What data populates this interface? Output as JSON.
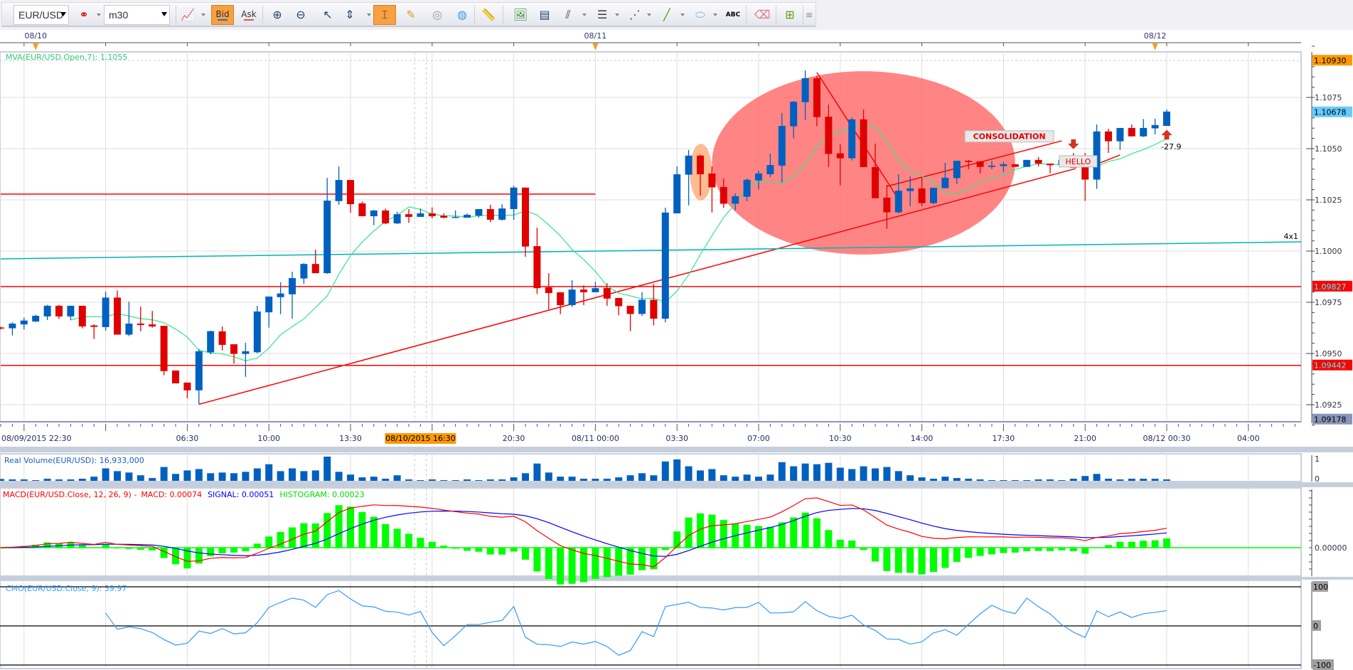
{
  "toolbar": {
    "symbol": "EUR/USD",
    "timeframe": "m30",
    "bid_label": "Bid",
    "ask_label": "Ask",
    "text_tool_label": "ABC"
  },
  "chart_data": {
    "type": "candlestick",
    "symbol": "EUR/USD",
    "interval": "m30",
    "x_start": "08/09/2015 22:30",
    "colors": {
      "up": "#0060c0",
      "down": "#e00000",
      "mva": "#2ee88a",
      "macd": "#ff0000",
      "signal": "#0000ff",
      "histogram": "#00ff00",
      "cmo": "#3399ff",
      "volume": "#0060c0"
    },
    "date_markers": [
      {
        "label": "08/10",
        "index": 3
      },
      {
        "label": "08/11",
        "index": 51
      },
      {
        "label": "08/12",
        "index": 99
      }
    ],
    "time_labels": [
      {
        "label": "08/09/2015 22:30",
        "index": 0
      },
      {
        "label": "06:30",
        "index": 16
      },
      {
        "label": "10:00",
        "index": 23
      },
      {
        "label": "13:30",
        "index": 30
      },
      {
        "label": "20:30",
        "index": 44
      },
      {
        "label": "08/11 00:00",
        "index": 51
      },
      {
        "label": "03:30",
        "index": 58
      },
      {
        "label": "07:00",
        "index": 65
      },
      {
        "label": "10:30",
        "index": 72
      },
      {
        "label": "14:00",
        "index": 79
      },
      {
        "label": "17:30",
        "index": 86
      },
      {
        "label": "21:00",
        "index": 93
      },
      {
        "label": "08/12 00:30",
        "index": 100
      },
      {
        "label": "04:00",
        "index": 107
      }
    ],
    "crosshair": {
      "label": "08/10/2015 16:30",
      "index": 36
    },
    "y_axis": {
      "range": [
        1.0912,
        1.11
      ],
      "ticks": [
        "1.1075",
        "1.1050",
        "1.1025",
        "1.1000",
        "1.0975",
        "1.0950",
        "1.0925"
      ],
      "markers": [
        {
          "label": "1.10930",
          "bg": "#ff9900",
          "fg": "#000000"
        },
        {
          "label": "1.10678",
          "bg": "#66ccff",
          "fg": "#000000"
        },
        {
          "label": "1.09827",
          "bg": "#ff0000",
          "fg": "#33ffff"
        },
        {
          "label": "1.09442",
          "bg": "#ff0000",
          "fg": "#33ffff"
        },
        {
          "label": "1.09178",
          "bg": "#8a96b8",
          "fg": "#000000"
        }
      ]
    },
    "mva": {
      "label": "MVA(EUR/USD.Open,7): 1.1055",
      "period": 7,
      "source": "open"
    },
    "candles": [
      [
        1.09627,
        1.09631,
        1.09617,
        1.09623
      ],
      [
        1.09623,
        1.09652,
        1.09588,
        1.09646
      ],
      [
        1.09642,
        1.09675,
        1.09617,
        1.09661
      ],
      [
        1.09656,
        1.09689,
        1.09654,
        1.09684
      ],
      [
        1.09681,
        1.09737,
        1.09663,
        1.09733
      ],
      [
        1.09733,
        1.09737,
        1.09669,
        1.09681
      ],
      [
        1.09681,
        1.09733,
        1.09663,
        1.09733
      ],
      [
        1.09733,
        1.09733,
        1.09623,
        1.09632
      ],
      [
        1.09637,
        1.09642,
        1.09571,
        1.0963
      ],
      [
        1.09629,
        1.09802,
        1.09611,
        1.09773
      ],
      [
        1.09773,
        1.09808,
        1.09592,
        1.09592
      ],
      [
        1.09592,
        1.09753,
        1.09585,
        1.09646
      ],
      [
        1.09646,
        1.09729,
        1.09608,
        1.09639
      ],
      [
        1.09642,
        1.09708,
        1.09626,
        1.09632
      ],
      [
        1.09635,
        1.09635,
        1.09394,
        1.09414
      ],
      [
        1.09417,
        1.09417,
        1.09354,
        1.09354
      ],
      [
        1.09358,
        1.09358,
        1.09281,
        1.0932
      ],
      [
        1.0932,
        1.09522,
        1.09252,
        1.09511
      ],
      [
        1.09506,
        1.09611,
        1.09496,
        1.09609
      ],
      [
        1.09608,
        1.09632,
        1.09515,
        1.09542
      ],
      [
        1.09545,
        1.09545,
        1.0945,
        1.09498
      ],
      [
        1.09498,
        1.09552,
        1.09386,
        1.09511
      ],
      [
        1.09506,
        1.09733,
        1.09501,
        1.09705
      ],
      [
        1.09701,
        1.09778,
        1.09626,
        1.09778
      ],
      [
        1.09775,
        1.09848,
        1.09692,
        1.09793
      ],
      [
        1.09789,
        1.09899,
        1.0967,
        1.09868
      ],
      [
        1.09866,
        1.09941,
        1.0984,
        1.09937
      ],
      [
        1.09937,
        1.10007,
        1.09892,
        1.09892
      ],
      [
        1.09892,
        1.10357,
        1.09889,
        1.10246
      ],
      [
        1.10244,
        1.10413,
        1.10226,
        1.10347
      ],
      [
        1.10347,
        1.10347,
        1.10187,
        1.10229
      ],
      [
        1.10233,
        1.10242,
        1.1017,
        1.1017
      ],
      [
        1.1017,
        1.10201,
        1.10126,
        1.10198
      ],
      [
        1.10198,
        1.10207,
        1.10132,
        1.10135
      ],
      [
        1.10135,
        1.10192,
        1.10132,
        1.1018
      ],
      [
        1.1018,
        1.10205,
        1.10138,
        1.10167
      ],
      [
        1.10167,
        1.10207,
        1.10167,
        1.10184
      ],
      [
        1.10184,
        1.10213,
        1.1016,
        1.1017
      ],
      [
        1.10172,
        1.10184,
        1.1016,
        1.10163
      ],
      [
        1.10163,
        1.10198,
        1.10161,
        1.10167
      ],
      [
        1.10163,
        1.10184,
        1.10163,
        1.10177
      ],
      [
        1.10173,
        1.10205,
        1.10163,
        1.10205
      ],
      [
        1.10205,
        1.10226,
        1.10141,
        1.10153
      ],
      [
        1.10153,
        1.10228,
        1.10149,
        1.10208
      ],
      [
        1.10205,
        1.10319,
        1.10153,
        1.1031
      ],
      [
        1.1031,
        1.1031,
        1.09972,
        1.10022
      ],
      [
        1.10024,
        1.10114,
        1.0979,
        1.09819
      ],
      [
        1.09823,
        1.09892,
        1.09715,
        1.09795
      ],
      [
        1.09799,
        1.09799,
        1.09692,
        1.09736
      ],
      [
        1.09736,
        1.09858,
        1.09727,
        1.09812
      ],
      [
        1.09812,
        1.09833,
        1.09736,
        1.09799
      ],
      [
        1.09799,
        1.0985,
        1.09799,
        1.09819
      ],
      [
        1.0982,
        1.09843,
        1.09733,
        1.09768
      ],
      [
        1.09771,
        1.09771,
        1.09687,
        1.09731
      ],
      [
        1.09733,
        1.09733,
        1.09609,
        1.09693
      ],
      [
        1.09693,
        1.09799,
        1.09683,
        1.09762
      ],
      [
        1.09762,
        1.0984,
        1.09637,
        1.0967
      ],
      [
        1.0967,
        1.10212,
        1.09652,
        1.10188
      ],
      [
        1.10184,
        1.10413,
        1.10184,
        1.10375
      ],
      [
        1.10373,
        1.10494,
        1.10223,
        1.10466
      ],
      [
        1.10466,
        1.10471,
        1.10271,
        1.10375
      ],
      [
        1.10379,
        1.10413,
        1.10188,
        1.10311
      ],
      [
        1.10313,
        1.10354,
        1.10211,
        1.10231
      ],
      [
        1.10231,
        1.10282,
        1.10199,
        1.10268
      ],
      [
        1.10265,
        1.10354,
        1.10243,
        1.10348
      ],
      [
        1.10345,
        1.10393,
        1.103,
        1.10379
      ],
      [
        1.10375,
        1.10476,
        1.10361,
        1.1042
      ],
      [
        1.10417,
        1.10674,
        1.10335,
        1.10611
      ],
      [
        1.10609,
        1.10733,
        1.1055,
        1.10729
      ],
      [
        1.10727,
        1.10882,
        1.1064,
        1.10844
      ],
      [
        1.10844,
        1.10855,
        1.10609,
        1.10654
      ],
      [
        1.10656,
        1.10715,
        1.1041,
        1.10474
      ],
      [
        1.10477,
        1.10521,
        1.10321,
        1.10453
      ],
      [
        1.10453,
        1.10653,
        1.10442,
        1.10643
      ],
      [
        1.10643,
        1.10691,
        1.1041,
        1.1041
      ],
      [
        1.1041,
        1.10525,
        1.10258,
        1.10258
      ],
      [
        1.10261,
        1.10323,
        1.10109,
        1.10189
      ],
      [
        1.10189,
        1.10375,
        1.10184,
        1.10295
      ],
      [
        1.10293,
        1.10365,
        1.10219,
        1.10306
      ],
      [
        1.10306,
        1.10361,
        1.10219,
        1.10234
      ],
      [
        1.10234,
        1.10309,
        1.10228,
        1.10309
      ],
      [
        1.10307,
        1.10431,
        1.10307,
        1.10358
      ],
      [
        1.10356,
        1.10441,
        1.10327,
        1.10441
      ],
      [
        1.10441,
        1.10445,
        1.104,
        1.10435
      ],
      [
        1.10438,
        1.10438,
        1.10379,
        1.10411
      ],
      [
        1.10411,
        1.10441,
        1.104,
        1.10417
      ],
      [
        1.10415,
        1.10435,
        1.10386,
        1.10424
      ],
      [
        1.10424,
        1.10424,
        1.10411,
        1.10411
      ],
      [
        1.10411,
        1.10445,
        1.10411,
        1.10445
      ],
      [
        1.10445,
        1.10459,
        1.10413,
        1.10427
      ],
      [
        1.10427,
        1.10427,
        1.10379,
        1.10419
      ],
      [
        1.10419,
        1.10445,
        1.10413,
        1.10445
      ],
      [
        1.10427,
        1.10479,
        1.10407,
        1.10407
      ],
      [
        1.10411,
        1.10479,
        1.10245,
        1.10349
      ],
      [
        1.10349,
        1.10618,
        1.10304,
        1.10584
      ],
      [
        1.10584,
        1.10597,
        1.10479,
        1.10536
      ],
      [
        1.10536,
        1.10601,
        1.10494,
        1.10601
      ],
      [
        1.10601,
        1.10618,
        1.1056,
        1.1056
      ],
      [
        1.1056,
        1.10645,
        1.10557,
        1.10601
      ],
      [
        1.10599,
        1.10646,
        1.1057,
        1.10615
      ],
      [
        1.10611,
        1.10691,
        1.10611,
        1.10681
      ]
    ],
    "horizontal_lines": [
      {
        "price": 1.09827,
        "from": 0,
        "to": 112,
        "color": "#ff0000"
      },
      {
        "price": 1.09442,
        "from": 0,
        "to": 112,
        "color": "#ff0000"
      },
      {
        "price": 1.10278,
        "from": 0,
        "to": 51,
        "color": "#ff0000"
      }
    ],
    "trend_lines": [
      {
        "from": [
          17,
          1.09252
        ],
        "to": [
          92.2,
          1.10403
        ],
        "color": "#ff0000"
      },
      {
        "from": [
          76,
          1.10316
        ],
        "to": [
          91,
          1.10538
        ],
        "color": "#ff0000"
      },
      {
        "from": [
          93.8,
          1.1042
        ],
        "to": [
          96,
          1.10469
        ],
        "color": "#ff0000"
      },
      {
        "from": [
          70,
          1.10872
        ],
        "to": [
          77,
          1.10253
        ],
        "color": "#ff0000"
      },
      {
        "from": [
          0,
          1.09962
        ],
        "to": [
          111.6,
          1.10045
        ],
        "color": "#00b4b4",
        "label": "4x1"
      }
    ],
    "ellipses": [
      {
        "index_range": [
          61,
          87
        ],
        "price_range": [
          1.09983,
          1.10878
        ],
        "color": "#ff6666"
      },
      {
        "index_range": [
          59.1,
          61
        ],
        "price_range": [
          1.10247,
          1.10524
        ],
        "color": "#ffaa77"
      }
    ],
    "annotations": [
      {
        "text": "CONSOLIDATION",
        "index": 86.5,
        "price": 1.1056
      },
      {
        "text": "HELLO",
        "index": 92.4,
        "price": 1.10438
      }
    ],
    "arrows": [
      {
        "direction": "down",
        "index": 92,
        "price": 1.1052
      },
      {
        "direction": "up",
        "index": 100,
        "price": 1.1057,
        "label": "-27.9"
      }
    ],
    "volume": {
      "label": "Real Volume(EUR/USD): 16,933,000",
      "axis_labels": [
        "1",
        "0"
      ],
      "values_relative": [
        8,
        6,
        6,
        3,
        9,
        6,
        6,
        9,
        18,
        54,
        42,
        36,
        24,
        12,
        60,
        30,
        45,
        51,
        33,
        36,
        33,
        39,
        54,
        72,
        42,
        54,
        42,
        45,
        105,
        39,
        27,
        15,
        18,
        9,
        24,
        6,
        3,
        6,
        3,
        3,
        6,
        3,
        6,
        6,
        15,
        33,
        75,
        36,
        18,
        18,
        9,
        9,
        9,
        15,
        24,
        33,
        24,
        84,
        93,
        63,
        45,
        51,
        24,
        18,
        27,
        18,
        27,
        81,
        63,
        75,
        72,
        78,
        57,
        51,
        63,
        54,
        60,
        42,
        24,
        15,
        9,
        18,
        12,
        9,
        6,
        3,
        3,
        3,
        3,
        6,
        6,
        3,
        9,
        21,
        30,
        9,
        6,
        9,
        9,
        9,
        6
      ]
    },
    "macd": {
      "title": "MACD(EUR/USD.Close, 12, 26, 9) -",
      "macd_label": "MACD: 0.00074",
      "signal_label": "SIGNAL: 0.00051",
      "histogram_label": "HISTOGRAM: 0.00023",
      "zero_label": "0.00000",
      "fast": 12,
      "slow": 26,
      "signal": 9
    },
    "cmo": {
      "label": "CMO(EUR/USD.Close, 9): 39.97",
      "period": 9,
      "axis_labels": [
        "100",
        "0",
        "-100"
      ]
    }
  }
}
